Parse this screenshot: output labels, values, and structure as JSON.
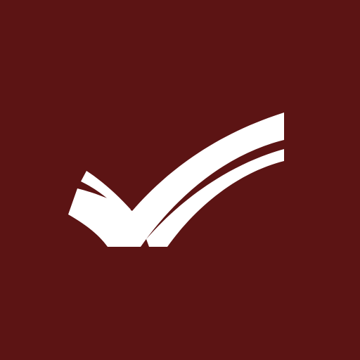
{
  "app_icon": {
    "icon": "double-checkmark-icon",
    "background_color": "#5c1414",
    "mark_color": "#ffffff"
  }
}
